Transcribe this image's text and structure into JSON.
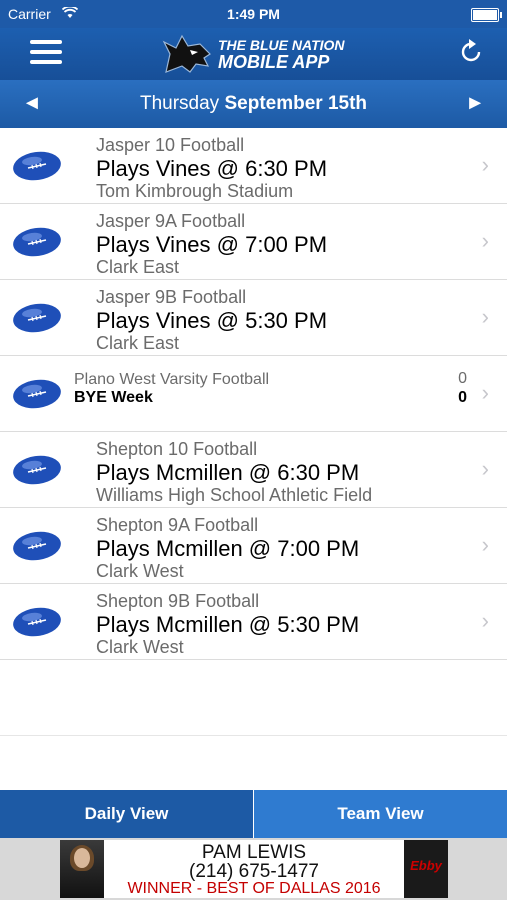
{
  "status_bar": {
    "carrier": "Carrier",
    "time": "1:49 PM",
    "battery_level": 1.0
  },
  "header": {
    "logo_line1": "THE BLUE NATION",
    "logo_line2": "MOBILE APP",
    "menu_icon": "hamburger-menu-icon",
    "refresh_icon": "refresh-icon"
  },
  "date_nav": {
    "prev_arrow": "◄",
    "next_arrow": "►",
    "weekday": "Thursday",
    "date": "September 15th"
  },
  "games": [
    {
      "team": "Jasper 10 Football",
      "game": "Plays Vines @ 6:30 PM",
      "venue": "Tom Kimbrough Stadium",
      "icon": "football-icon"
    },
    {
      "team": "Jasper 9A Football",
      "game": "Plays Vines @ 7:00 PM",
      "venue": "Clark East",
      "icon": "football-icon"
    },
    {
      "team": "Jasper 9B Football",
      "game": "Plays Vines @ 5:30 PM",
      "venue": "Clark East",
      "icon": "football-icon"
    },
    {
      "team": "Plano West Varsity Football",
      "game": "BYE Week",
      "score_top": "0",
      "score_bottom": "0",
      "icon": "football-icon",
      "bye": true
    },
    {
      "team": "Shepton 10 Football",
      "game": "Plays Mcmillen @ 6:30 PM",
      "venue": "Williams High School Athletic Field",
      "icon": "football-icon"
    },
    {
      "team": "Shepton 9A Football",
      "game": "Plays Mcmillen @ 7:00 PM",
      "venue": "Clark West",
      "icon": "football-icon"
    },
    {
      "team": "Shepton 9B Football",
      "game": "Plays Mcmillen @ 5:30 PM",
      "venue": "Clark West",
      "icon": "football-icon"
    }
  ],
  "tabs": {
    "daily": "Daily View",
    "team": "Team View"
  },
  "ad": {
    "name": "PAM LEWIS",
    "phone": "(214) 675-1477",
    "slogan": "WINNER - BEST OF DALLAS 2016",
    "logo_text": "Ebby"
  },
  "colors": {
    "primary": "#1d5aa5",
    "accent": "#2f7bd0",
    "ad_red": "#c40000"
  }
}
